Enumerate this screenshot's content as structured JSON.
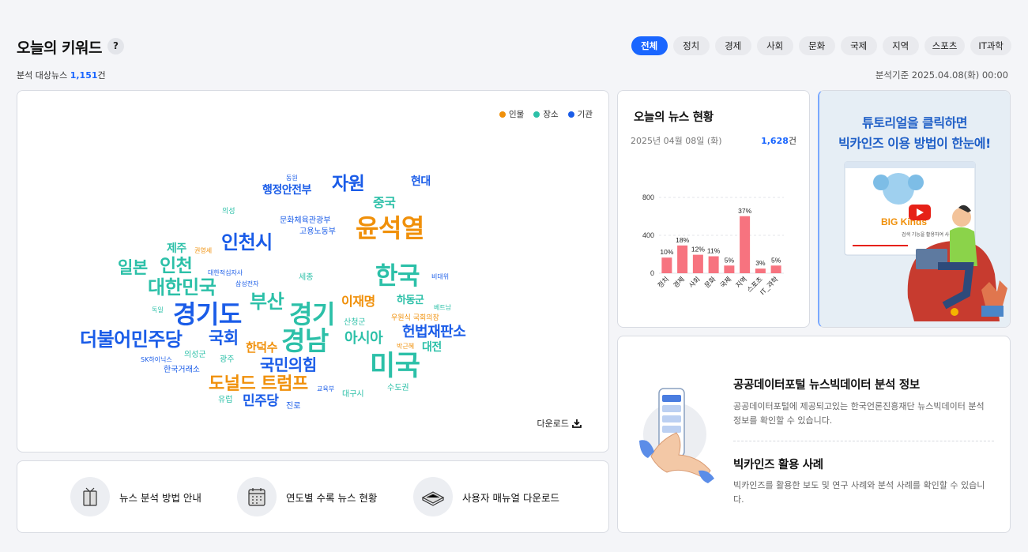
{
  "header": {
    "title": "오늘의 키워드",
    "help": "?",
    "tabs": [
      "전체",
      "정치",
      "경제",
      "사회",
      "문화",
      "국제",
      "지역",
      "스포츠",
      "IT과학"
    ],
    "active_tab": 0,
    "subinfo_prefix": "분석 대상뉴스 ",
    "subinfo_count": "1,151",
    "subinfo_suffix": "건",
    "basis": "분석기준 2025.04.08(화) 00:00"
  },
  "legend": {
    "person": "인물",
    "place": "장소",
    "org": "기관",
    "colors": {
      "person": "#f0900a",
      "place": "#2cc0a8",
      "org": "#1a5ce8"
    }
  },
  "wordcloud": [
    {
      "text": "동원",
      "type": "org"
    },
    {
      "text": "행정안전부",
      "type": "org"
    },
    {
      "text": "자원",
      "type": "org"
    },
    {
      "text": "현대",
      "type": "org"
    },
    {
      "text": "중국",
      "type": "place"
    },
    {
      "text": "의성",
      "type": "place"
    },
    {
      "text": "문화체육관광부",
      "type": "org"
    },
    {
      "text": "고용노동부",
      "type": "org"
    },
    {
      "text": "윤석열",
      "type": "person"
    },
    {
      "text": "인천시",
      "type": "org"
    },
    {
      "text": "제주",
      "type": "place"
    },
    {
      "text": "권영세",
      "type": "person"
    },
    {
      "text": "일본",
      "type": "place"
    },
    {
      "text": "인천",
      "type": "place"
    },
    {
      "text": "대한적십자사",
      "type": "org"
    },
    {
      "text": "한국",
      "type": "place"
    },
    {
      "text": "비대위",
      "type": "org"
    },
    {
      "text": "대한민국",
      "type": "place"
    },
    {
      "text": "삼성전자",
      "type": "org"
    },
    {
      "text": "세종",
      "type": "place"
    },
    {
      "text": "부산",
      "type": "place"
    },
    {
      "text": "이재명",
      "type": "person"
    },
    {
      "text": "하동군",
      "type": "place"
    },
    {
      "text": "경기도",
      "type": "org"
    },
    {
      "text": "독일",
      "type": "place"
    },
    {
      "text": "경기",
      "type": "place"
    },
    {
      "text": "베트남",
      "type": "place"
    },
    {
      "text": "우원식 국회의장",
      "type": "person"
    },
    {
      "text": "산청군",
      "type": "place"
    },
    {
      "text": "헌법재판소",
      "type": "org"
    },
    {
      "text": "더불어민주당",
      "type": "org"
    },
    {
      "text": "국회",
      "type": "org"
    },
    {
      "text": "경남",
      "type": "place"
    },
    {
      "text": "아시아",
      "type": "place"
    },
    {
      "text": "한덕수",
      "type": "person"
    },
    {
      "text": "박근혜",
      "type": "person"
    },
    {
      "text": "대전",
      "type": "place"
    },
    {
      "text": "의성군",
      "type": "place"
    },
    {
      "text": "SK하이닉스",
      "type": "org"
    },
    {
      "text": "광주",
      "type": "place"
    },
    {
      "text": "국민의힘",
      "type": "org"
    },
    {
      "text": "미국",
      "type": "place"
    },
    {
      "text": "한국거래소",
      "type": "org"
    },
    {
      "text": "도널드 트럼프",
      "type": "person"
    },
    {
      "text": "수도권",
      "type": "place"
    },
    {
      "text": "교육부",
      "type": "org"
    },
    {
      "text": "유럽",
      "type": "place"
    },
    {
      "text": "민주당",
      "type": "org"
    },
    {
      "text": "대구시",
      "type": "place"
    },
    {
      "text": "진로",
      "type": "org"
    }
  ],
  "download": {
    "label": "다운로드"
  },
  "links": [
    {
      "label": "뉴스 분석 방법 안내",
      "icon": "hands-book-icon"
    },
    {
      "label": "연도별 수록 뉴스 현황",
      "icon": "calendar-icon"
    },
    {
      "label": "사용자 매뉴얼 다운로드",
      "icon": "manual-book-icon"
    }
  ],
  "news_status": {
    "title": "오늘의 뉴스 현황",
    "date": "2025년 04월 08일 (화)",
    "count": "1,628",
    "count_suffix": "건"
  },
  "chart_data": {
    "type": "bar",
    "categories": [
      "정치",
      "경제",
      "사회",
      "문화",
      "국제",
      "지역",
      "스포츠",
      "IT_과학"
    ],
    "values": [
      165,
      293,
      195,
      179,
      81,
      602,
      49,
      81
    ],
    "data_labels": [
      "10%",
      "18%",
      "12%",
      "11%",
      "5%",
      "37%",
      "3%",
      "5%"
    ],
    "yticks": [
      0,
      400,
      800
    ],
    "ylim": [
      0,
      1000
    ],
    "color": "#f7737f",
    "grid": true
  },
  "promo": {
    "line1": "튜토리얼을 클릭하면",
    "line2": "빅카인즈 이용 방법이 한눈에!",
    "brand": "BIG Kinds",
    "caption": "검색 기능을 활용하여 사용"
  },
  "info": [
    {
      "title": "공공데이터포털 뉴스빅데이터 분석 정보",
      "desc": "공공데이터포털에 제공되고있는 한국언론진흥재단 뉴스빅데이터 분석 정보를 확인할 수 있습니다."
    },
    {
      "title": "빅카인즈 활용 사례",
      "desc": "빅카인즈를 활용한 보도 및 연구 사례와 분석 사례를 확인할 수 있습니다."
    }
  ]
}
